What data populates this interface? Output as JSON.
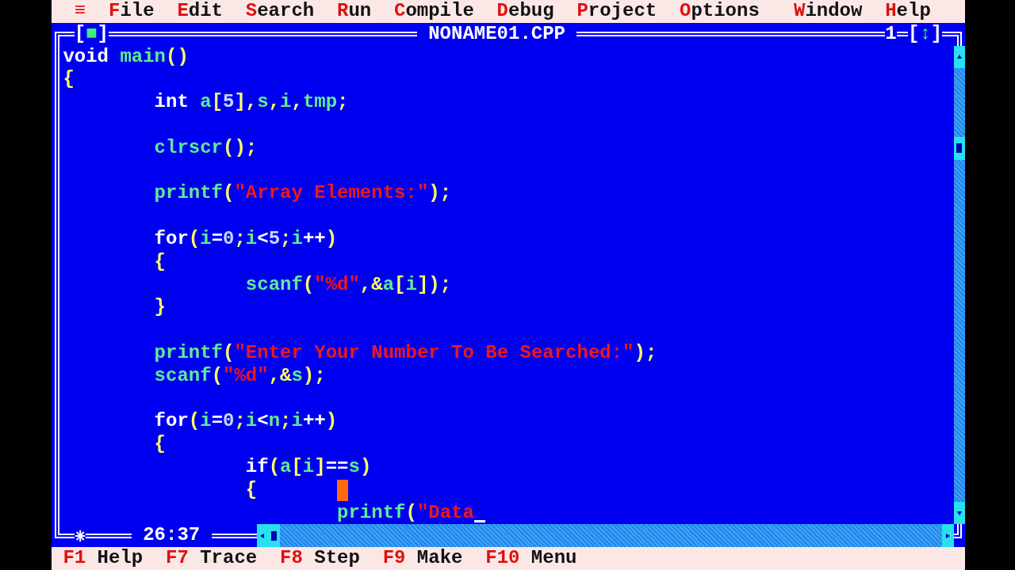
{
  "menu": [
    {
      "label": "≡",
      "kind": "system"
    },
    {
      "label": "File",
      "kind": "menu"
    },
    {
      "label": "Edit",
      "kind": "menu"
    },
    {
      "label": "Search",
      "kind": "menu"
    },
    {
      "label": "Run",
      "kind": "menu"
    },
    {
      "label": "Compile",
      "kind": "menu"
    },
    {
      "label": "Debug",
      "kind": "menu"
    },
    {
      "label": "Project",
      "kind": "menu"
    },
    {
      "label": "Options",
      "kind": "menu"
    },
    {
      "label": "Window",
      "kind": "right-menu"
    },
    {
      "label": "Help",
      "kind": "right-menu"
    }
  ],
  "window": {
    "title": "NONAME01.CPP",
    "close_button": "[■]",
    "number": "1",
    "zoom_button": "[↕]",
    "modified": true,
    "cursor_position": "26:37",
    "lines": [
      {
        "kind": "code",
        "tokens": [
          {
            "kind": "keyword",
            "text": "void "
          },
          {
            "kind": "identifier",
            "text": "main"
          },
          {
            "kind": "symbol",
            "text": "()"
          }
        ]
      },
      {
        "kind": "code",
        "tokens": [
          {
            "kind": "symbol",
            "text": "{"
          }
        ]
      },
      {
        "kind": "code",
        "tokens": [
          {
            "kind": "keyword",
            "text": "        int "
          },
          {
            "kind": "identifier",
            "text": "a"
          },
          {
            "kind": "symbol",
            "text": "["
          },
          {
            "kind": "number",
            "text": "5"
          },
          {
            "kind": "symbol",
            "text": "],"
          },
          {
            "kind": "identifier",
            "text": "s"
          },
          {
            "kind": "symbol",
            "text": ","
          },
          {
            "kind": "identifier",
            "text": "i"
          },
          {
            "kind": "symbol",
            "text": ","
          },
          {
            "kind": "identifier",
            "text": "tmp"
          },
          {
            "kind": "symbol",
            "text": ";"
          }
        ]
      },
      {
        "kind": "blank"
      },
      {
        "kind": "code",
        "tokens": [
          {
            "kind": "identifier",
            "text": "        clrscr"
          },
          {
            "kind": "symbol",
            "text": "();"
          }
        ]
      },
      {
        "kind": "blank"
      },
      {
        "kind": "code",
        "tokens": [
          {
            "kind": "identifier",
            "text": "        printf"
          },
          {
            "kind": "symbol",
            "text": "("
          },
          {
            "kind": "string",
            "text": "\"Array Elements:\""
          },
          {
            "kind": "symbol",
            "text": ");"
          }
        ]
      },
      {
        "kind": "blank"
      },
      {
        "kind": "code",
        "tokens": [
          {
            "kind": "keyword",
            "text": "        for"
          },
          {
            "kind": "symbol",
            "text": "("
          },
          {
            "kind": "identifier",
            "text": "i"
          },
          {
            "kind": "operator",
            "text": "="
          },
          {
            "kind": "number",
            "text": "0"
          },
          {
            "kind": "symbol",
            "text": ";"
          },
          {
            "kind": "identifier",
            "text": "i"
          },
          {
            "kind": "operator",
            "text": "<"
          },
          {
            "kind": "number",
            "text": "5"
          },
          {
            "kind": "symbol",
            "text": ";"
          },
          {
            "kind": "identifier",
            "text": "i"
          },
          {
            "kind": "operator",
            "text": "++"
          },
          {
            "kind": "symbol",
            "text": ")"
          }
        ]
      },
      {
        "kind": "code",
        "tokens": [
          {
            "kind": "symbol",
            "text": "        {"
          }
        ]
      },
      {
        "kind": "code",
        "tokens": [
          {
            "kind": "identifier",
            "text": "                scanf"
          },
          {
            "kind": "symbol",
            "text": "("
          },
          {
            "kind": "string",
            "text": "\"%d\""
          },
          {
            "kind": "symbol",
            "text": ",&"
          },
          {
            "kind": "identifier",
            "text": "a"
          },
          {
            "kind": "symbol",
            "text": "["
          },
          {
            "kind": "identifier",
            "text": "i"
          },
          {
            "kind": "symbol",
            "text": "]);"
          }
        ]
      },
      {
        "kind": "code",
        "tokens": [
          {
            "kind": "symbol",
            "text": "        }"
          }
        ]
      },
      {
        "kind": "blank"
      },
      {
        "kind": "code",
        "tokens": [
          {
            "kind": "identifier",
            "text": "        printf"
          },
          {
            "kind": "symbol",
            "text": "("
          },
          {
            "kind": "string",
            "text": "\"Enter Your Number To Be Searched:\""
          },
          {
            "kind": "symbol",
            "text": ");"
          }
        ]
      },
      {
        "kind": "code",
        "tokens": [
          {
            "kind": "identifier",
            "text": "        scanf"
          },
          {
            "kind": "symbol",
            "text": "("
          },
          {
            "kind": "string",
            "text": "\"%d\""
          },
          {
            "kind": "symbol",
            "text": ",&"
          },
          {
            "kind": "identifier",
            "text": "s"
          },
          {
            "kind": "symbol",
            "text": ");"
          }
        ]
      },
      {
        "kind": "blank"
      },
      {
        "kind": "code",
        "tokens": [
          {
            "kind": "keyword",
            "text": "        for"
          },
          {
            "kind": "symbol",
            "text": "("
          },
          {
            "kind": "identifier",
            "text": "i"
          },
          {
            "kind": "operator",
            "text": "="
          },
          {
            "kind": "number",
            "text": "0"
          },
          {
            "kind": "symbol",
            "text": ";"
          },
          {
            "kind": "identifier",
            "text": "i"
          },
          {
            "kind": "operator",
            "text": "<"
          },
          {
            "kind": "identifier",
            "text": "n"
          },
          {
            "kind": "symbol",
            "text": ";"
          },
          {
            "kind": "identifier",
            "text": "i"
          },
          {
            "kind": "operator",
            "text": "++"
          },
          {
            "kind": "symbol",
            "text": ")"
          }
        ]
      },
      {
        "kind": "code",
        "tokens": [
          {
            "kind": "symbol",
            "text": "        {"
          }
        ]
      },
      {
        "kind": "code",
        "tokens": [
          {
            "kind": "keyword",
            "text": "                if"
          },
          {
            "kind": "symbol",
            "text": "("
          },
          {
            "kind": "identifier",
            "text": "a"
          },
          {
            "kind": "symbol",
            "text": "["
          },
          {
            "kind": "identifier",
            "text": "i"
          },
          {
            "kind": "symbol",
            "text": "]"
          },
          {
            "kind": "operator",
            "text": "=="
          },
          {
            "kind": "identifier",
            "text": "s"
          },
          {
            "kind": "symbol",
            "text": ")"
          }
        ]
      },
      {
        "kind": "code",
        "tokens": [
          {
            "kind": "symbol",
            "text": "                {"
          }
        ]
      },
      {
        "kind": "code",
        "tokens": [
          {
            "kind": "identifier",
            "text": "                        printf"
          },
          {
            "kind": "symbol",
            "text": "("
          },
          {
            "kind": "string",
            "text": "\"Data"
          }
        ]
      }
    ]
  },
  "status_bar": [
    {
      "key": "F1",
      "label": "Help"
    },
    {
      "key": "F7",
      "label": "Trace"
    },
    {
      "key": "F8",
      "label": "Step"
    },
    {
      "key": "F9",
      "label": "Make"
    },
    {
      "key": "F10",
      "label": "Menu"
    }
  ]
}
